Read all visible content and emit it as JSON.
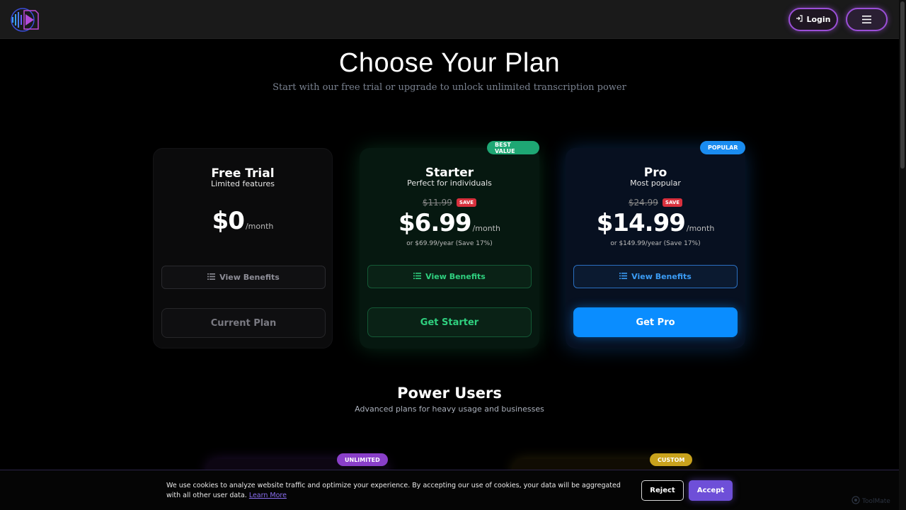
{
  "header": {
    "login_label": "Login"
  },
  "page": {
    "title": "Choose Your Plan",
    "subtitle": "Start with our free trial or upgrade to unlock unlimited transcription power"
  },
  "plans": [
    {
      "name": "Free Trial",
      "description": "Limited features",
      "price": "$0",
      "period": "/month",
      "benefits_label": "View Benefits",
      "cta_label": "Current Plan"
    },
    {
      "badge": "BEST VALUE",
      "name": "Starter",
      "description": "Perfect for individuals",
      "old_price": "$11.99",
      "save_label": "SAVE",
      "price": "$6.99",
      "period": "/month",
      "yearly": "or $69.99/year (Save 17%)",
      "benefits_label": "View Benefits",
      "cta_label": "Get Starter"
    },
    {
      "badge": "POPULAR",
      "name": "Pro",
      "description": "Most popular",
      "old_price": "$24.99",
      "save_label": "SAVE",
      "price": "$14.99",
      "period": "/month",
      "yearly": "or $149.99/year (Save 17%)",
      "benefits_label": "View Benefits",
      "cta_label": "Get Pro"
    }
  ],
  "power": {
    "title": "Power Users",
    "subtitle": "Advanced plans for heavy usage and businesses",
    "badges": [
      "UNLIMITED",
      "CUSTOM"
    ]
  },
  "cookie": {
    "text": "We use cookies to analyze website traffic and optimize your experience. By accepting our use of cookies, your data will be aggregated with all other user data.",
    "learn_more": "Learn More",
    "reject_label": "Reject",
    "accept_label": "Accept"
  },
  "watermark": "ToolMate",
  "colors": {
    "accent_purple": "#9b4fd8",
    "starter_green": "#2fd07f",
    "pro_blue": "#0a8dff",
    "save_red": "#d9303d"
  }
}
